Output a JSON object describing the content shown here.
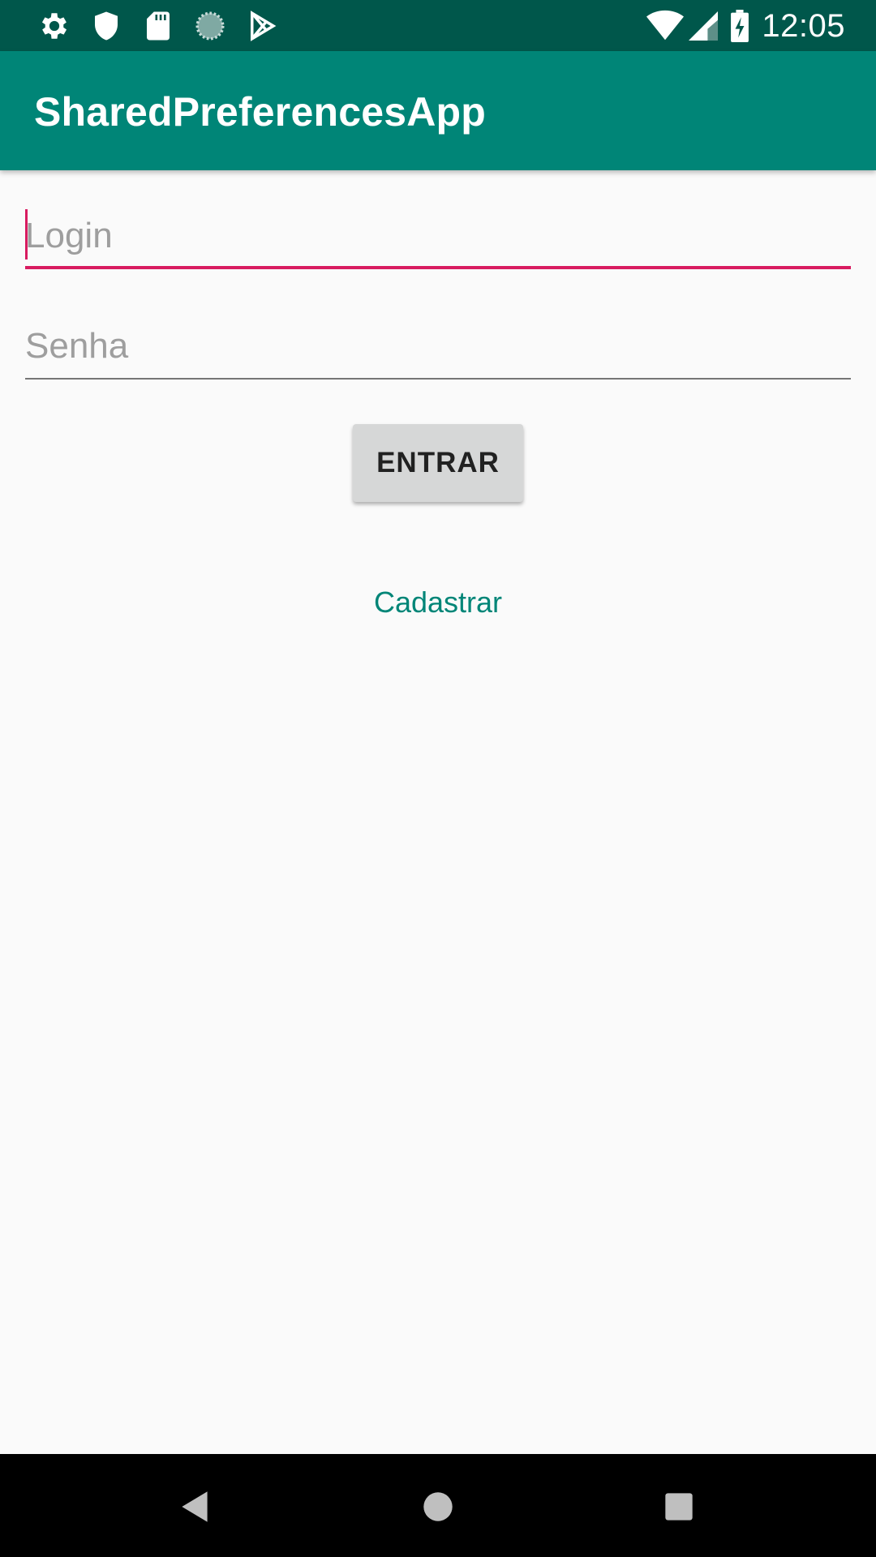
{
  "status_bar": {
    "time": "12:05",
    "left_icons": [
      "gear-icon",
      "shield-icon",
      "sd-card-icon",
      "sync-spinner-icon",
      "play-store-icon"
    ],
    "right_icons": [
      "wifi-icon",
      "cell-signal-icon",
      "battery-charging-icon"
    ]
  },
  "app_bar": {
    "title": "SharedPreferencesApp",
    "background": "#008577"
  },
  "form": {
    "login_placeholder": "Login",
    "senha_placeholder": "Senha",
    "login_value": "",
    "senha_value": "",
    "focus_color": "#d81b60"
  },
  "actions": {
    "entrar_label": "ENTRAR",
    "cadastrar_label": "Cadastrar"
  },
  "nav_bar": {
    "buttons": [
      "back-icon",
      "home-icon",
      "recents-icon"
    ]
  }
}
